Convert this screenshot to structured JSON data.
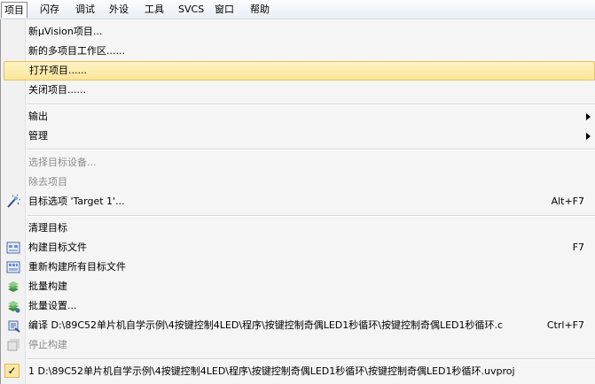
{
  "menubar": {
    "items": [
      "项目",
      "闪存",
      "调试",
      "外设",
      "工具",
      "SVCS",
      "窗口",
      "帮助"
    ]
  },
  "menu": {
    "new_uvision_project": "新µVision项目...",
    "new_multi_workspace": "新的多项目工作区......",
    "open_project": "打开项目......",
    "close_project": "关闭项目......",
    "export": "输出",
    "manage": "管理",
    "select_device": "选择目标设备...",
    "remove_item": "除去项目",
    "target_options": "目标选项 'Target 1'...",
    "target_options_shortcut": "Alt+F7",
    "clean_target": "清理目标",
    "build_target": "构建目标文件",
    "build_target_shortcut": "F7",
    "rebuild_all": "重新构建所有目标文件",
    "batch_build": "批量构建",
    "batch_setup": "批量设置...",
    "compile": "编译 D:\\89C52单片机自学示例\\4按键控制4LED\\程序\\按键控制奇偶LED1秒循环\\按键控制奇偶LED1秒循环.c",
    "compile_shortcut": "Ctrl+F7",
    "stop_build": "停止构建",
    "recent_project": "1 D:\\89C52单片机自学示例\\4按键控制4LED\\程序\\按键控制奇偶LED1秒循环\\按键控制奇偶LED1秒循环.uvproj"
  },
  "colors": {
    "highlight_bg": "#fbe59a",
    "highlight_border": "#e7c15a",
    "disabled_text": "#8d8d8d"
  }
}
